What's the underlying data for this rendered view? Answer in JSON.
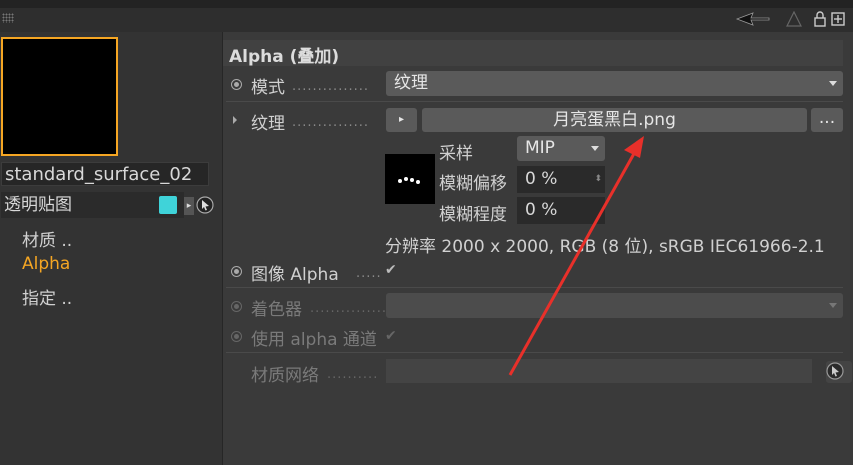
{
  "colors": {
    "accent_orange": "#f5a623",
    "swatch_cyan": "#3fd3d9",
    "arrow_red": "#e8302a"
  },
  "sidebar": {
    "material_name": "standard_surface_02",
    "channel_label": "透明贴图",
    "items": [
      {
        "label": "材质 ..",
        "active": false
      },
      {
        "label": "Alpha",
        "active": true
      },
      {
        "label": "指定 ..",
        "active": false
      }
    ]
  },
  "panel": {
    "title": "Alpha (叠加)",
    "mode": {
      "label": "模式",
      "dots": "...............",
      "value": "纹理"
    },
    "texture": {
      "label": "纹理",
      "dots": "...............",
      "filename": "月亮蛋黑白.png",
      "browse_label": "..."
    },
    "sampling": {
      "label": "采样",
      "value": "MIP"
    },
    "blur_offset": {
      "label": "模糊偏移",
      "value": "0 %"
    },
    "blur_scale": {
      "label": "模糊程度",
      "value": "0 %"
    },
    "resolution": "分辨率 2000 x 2000, RGB (8 位), sRGB IEC61966-2.1",
    "image_alpha": {
      "label": "图像 Alpha",
      "dots": ".....",
      "checked": true
    },
    "shader": {
      "label": "着色器",
      "dots": "...............",
      "value": ""
    },
    "use_alpha_channel": {
      "label": "使用 alpha 通道",
      "checked": true
    },
    "material_mesh": {
      "label": "材质网络",
      "dots": "..........",
      "value": ""
    }
  },
  "icons": [
    "grip-icon",
    "back-arrow-icon",
    "up-arrow-icon",
    "lock-icon",
    "new-window-icon",
    "pick-icon",
    "checkmark-icon"
  ]
}
